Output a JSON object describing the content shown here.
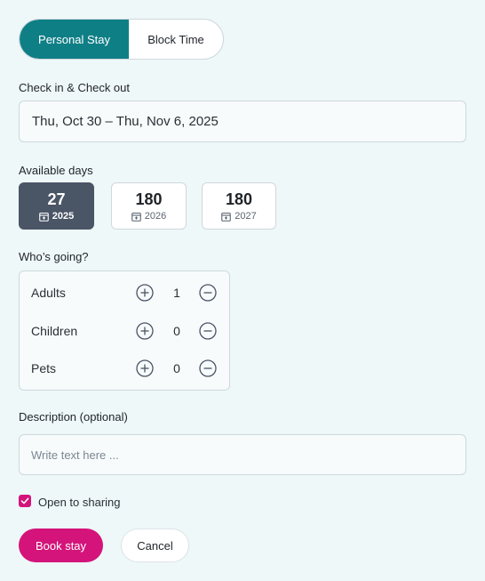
{
  "stay_type": {
    "options": [
      "Personal Stay",
      "Block Time"
    ],
    "selected": "Personal Stay"
  },
  "dates": {
    "label": "Check in & Check out",
    "value": "Thu, Oct 30 – Thu, Nov 6, 2025"
  },
  "available_days": {
    "label": "Available days",
    "years": [
      {
        "days": "27",
        "year": "2025",
        "selected": true
      },
      {
        "days": "180",
        "year": "2026",
        "selected": false
      },
      {
        "days": "180",
        "year": "2027",
        "selected": false
      }
    ]
  },
  "guests": {
    "label": "Who’s going?",
    "rows": [
      {
        "label": "Adults",
        "count": "1"
      },
      {
        "label": "Children",
        "count": "0"
      },
      {
        "label": "Pets",
        "count": "0"
      }
    ]
  },
  "description": {
    "label": "Description (optional)",
    "placeholder": "Write text here ..."
  },
  "sharing": {
    "label": "Open to sharing",
    "checked": true
  },
  "actions": {
    "primary": "Book stay",
    "secondary": "Cancel"
  },
  "colors": {
    "teal": "#0f7f86",
    "magenta": "#d4147a",
    "slate": "#4a5566"
  }
}
